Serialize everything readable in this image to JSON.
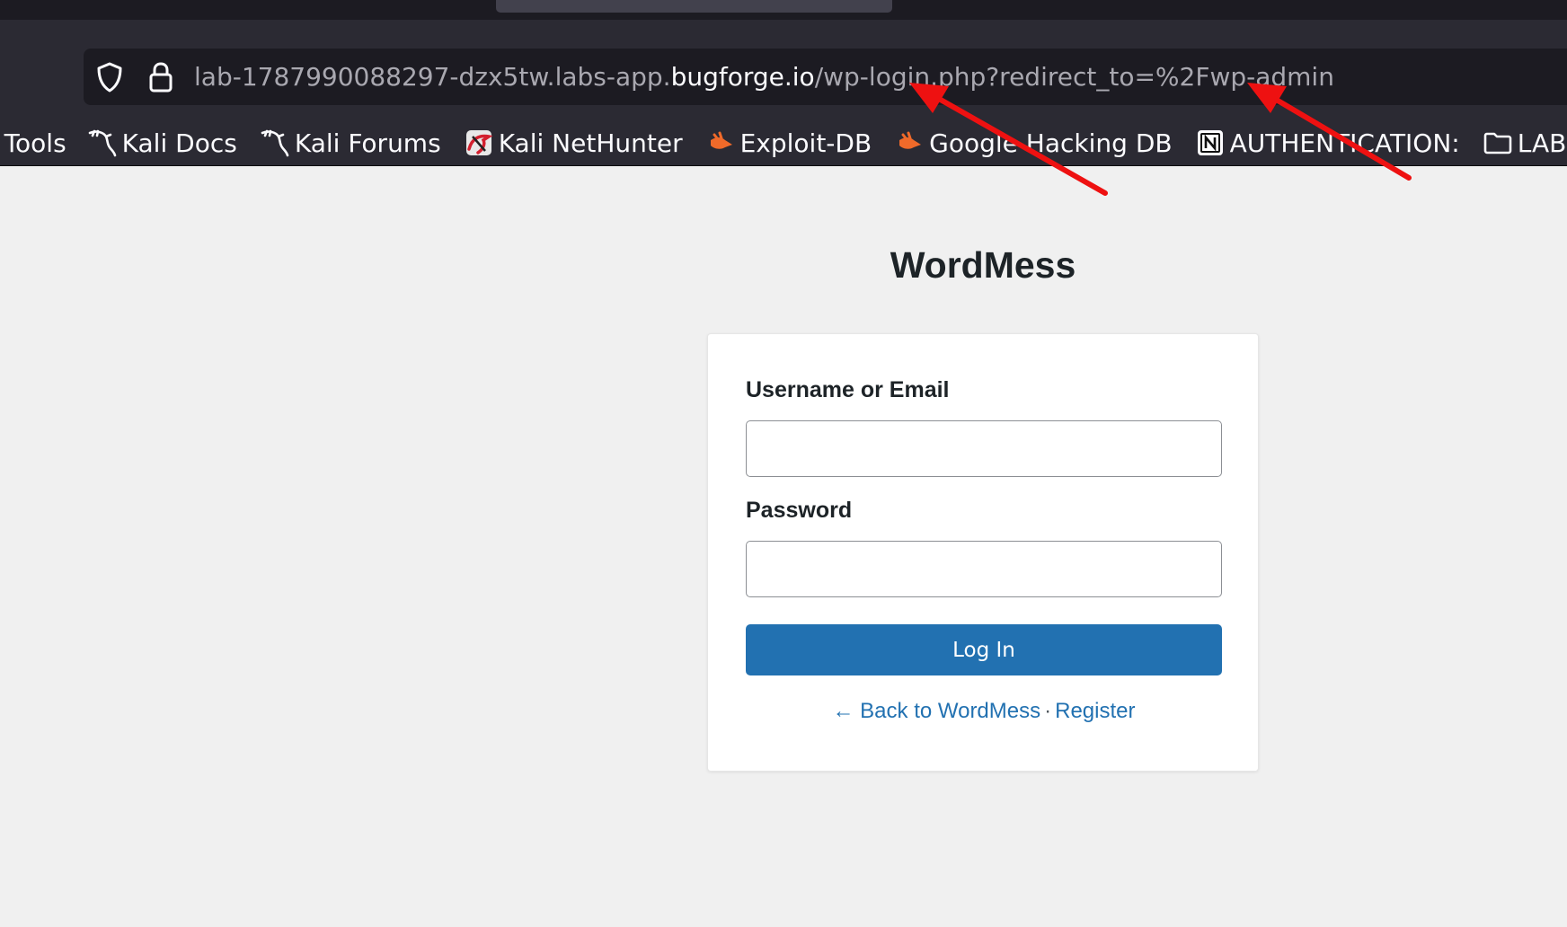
{
  "browser": {
    "url": {
      "prefix": "lab-1787990088297-dzx5tw.labs-app.",
      "host": "bugforge.io",
      "path": "/wp-login.php?redirect_to=%2Fwp-admin"
    },
    "icons": {
      "shield": "shield-icon",
      "lock": "lock-icon"
    },
    "bookmarks": [
      {
        "label": "i Tools",
        "icon": ""
      },
      {
        "label": "Kali Docs",
        "icon": "kali-dragon-icon"
      },
      {
        "label": "Kali Forums",
        "icon": "kali-dragon-icon"
      },
      {
        "label": "Kali NetHunter",
        "icon": "nethunter-icon"
      },
      {
        "label": "Exploit-DB",
        "icon": "exploit-db-icon"
      },
      {
        "label": "Google Hacking DB",
        "icon": "exploit-db-icon"
      },
      {
        "label": "AUTHENTICATION:",
        "icon": "notion-icon"
      },
      {
        "label": "LABS",
        "icon": "folder-icon"
      }
    ]
  },
  "annotation": {
    "arrow_color": "#ee1111"
  },
  "login": {
    "site_title": "WordMess",
    "username_label": "Username or Email",
    "username_value": "",
    "password_label": "Password",
    "password_value": "",
    "login_button": "Log In",
    "back_link": "← Back to WordMess",
    "separator": "·",
    "register_link": "Register",
    "accent_color": "#2271b1"
  }
}
